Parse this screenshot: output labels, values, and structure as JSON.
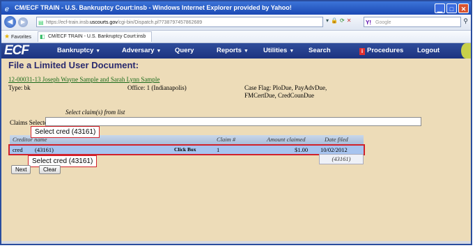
{
  "window": {
    "title": "CM/ECF TRAIN - U.S. Bankruptcy Court:insb - Windows Internet Explorer provided by Yahoo!"
  },
  "address_bar": {
    "url_prefix": "https://ecf-train.insb.",
    "url_host": "uscourts.gov",
    "url_rest": "/cgi-bin/Dispatch.pl?738797457862689",
    "search_placeholder": "Google"
  },
  "favorites_bar": {
    "label": "Favorites",
    "tab_title": "CM/ECF TRAIN - U.S. Bankruptcy Court:insb"
  },
  "ecf_menu": {
    "logo": "ECF",
    "items": [
      "Bankruptcy",
      "Adversary",
      "Query",
      "Reports",
      "Utilities",
      "Search",
      "Procedures",
      "Logout"
    ]
  },
  "page": {
    "title": "File a Limited User Document:",
    "case_link": "12-00031-13 Joseph Wayne Sample and Sarah Lynn Sample",
    "type_label": "Type: bk",
    "office_label": "Office: 1 (Indianapolis)",
    "case_flags_line1": "Case Flag: PloDue, PayAdvDue,",
    "case_flags_line2": "FMCertDue, CredCounDue",
    "select_hint": "Select claim(s) from list",
    "claims_selected_label": "Claims Selected:",
    "claims_selected_value": ""
  },
  "table": {
    "headers": [
      "Creditor name",
      "Claim #",
      "Amount claimed",
      "Date filed"
    ],
    "row": {
      "creditor": "cred",
      "creditor_id": "(43161)",
      "click_box": "Click Box",
      "claim_no": "1",
      "amount": "$1.00",
      "date": "10/02/2012"
    },
    "hover_note": "(43161)"
  },
  "callouts": {
    "top": "Select cred (43161)",
    "bottom": "Select cred (43161)"
  },
  "buttons": {
    "next": "Next",
    "clear": "Clear"
  }
}
